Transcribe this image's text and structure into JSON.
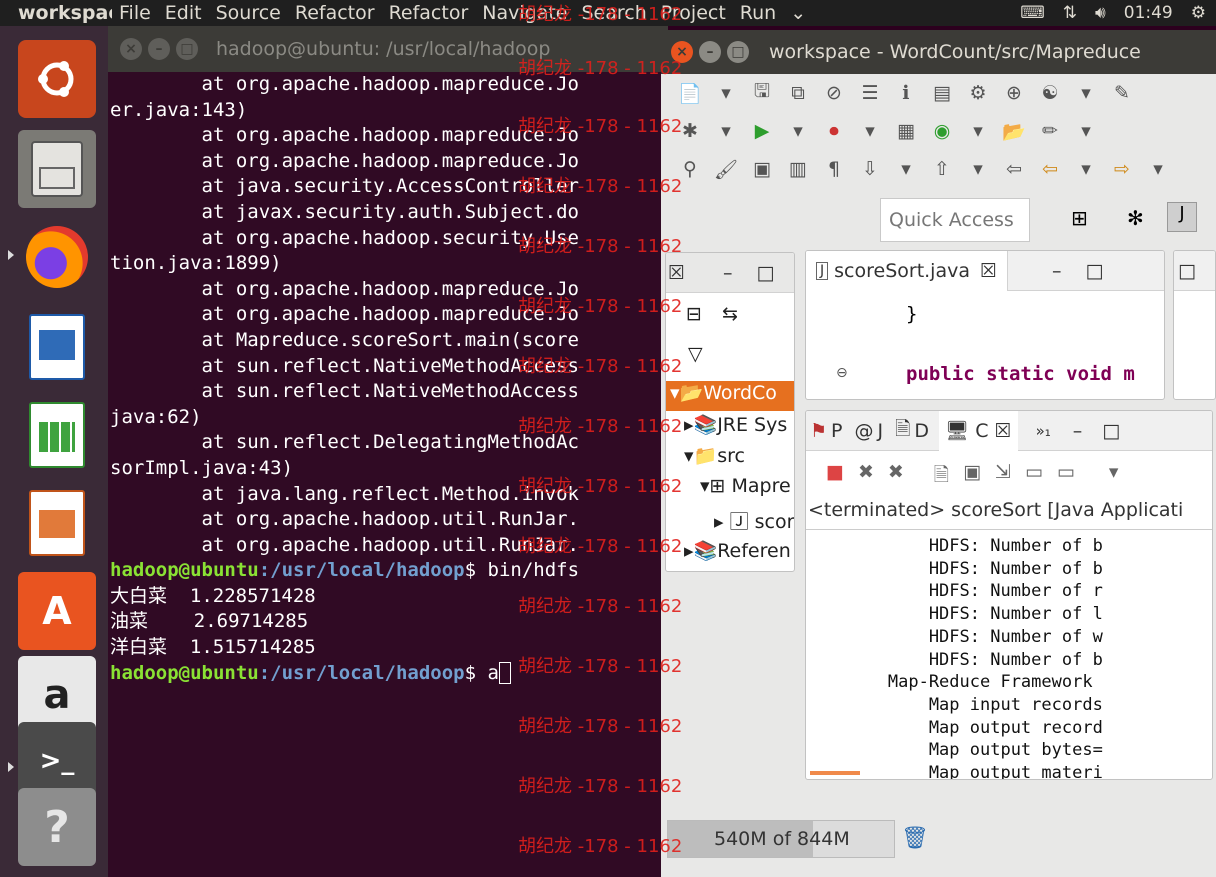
{
  "topbar": {
    "app_name": "workspace",
    "menu": [
      "File",
      "Edit",
      "Source",
      "Refactor",
      "Refactor",
      "Navigate",
      "Search",
      "Project",
      "Run"
    ],
    "clock": "01:49"
  },
  "terminal": {
    "title": "hadoop@ubuntu: /usr/local/hadoop",
    "lines": [
      "        at org.apache.hadoop.mapreduce.Jo",
      "er.java:143)",
      "        at org.apache.hadoop.mapreduce.Jo",
      "        at org.apache.hadoop.mapreduce.Jo",
      "        at java.security.AccessController",
      "        at javax.security.auth.Subject.do",
      "        at org.apache.hadoop.security.Use",
      "tion.java:1899)",
      "        at org.apache.hadoop.mapreduce.Jo",
      "        at org.apache.hadoop.mapreduce.Jo",
      "        at Mapreduce.scoreSort.main(score",
      "        at sun.reflect.NativeMethodAccess",
      "        at sun.reflect.NativeMethodAccess",
      "java:62)",
      "        at sun.reflect.DelegatingMethodAc",
      "sorImpl.java:43)",
      "        at java.lang.reflect.Method.invok",
      "        at org.apache.hadoop.util.RunJar.",
      "        at org.apache.hadoop.util.RunJar."
    ],
    "prompt_user": "hadoop@ubuntu",
    "prompt_path": ":/usr/local/hadoop",
    "prompt_sign": "$",
    "command1": " bin/hdfs",
    "results": [
      {
        "name": "大白菜",
        "value": "1.228571428"
      },
      {
        "name": "油菜",
        "value": "2.69714285"
      },
      {
        "name": "洋白菜",
        "value": "1.515714285"
      }
    ],
    "command2": " a"
  },
  "eclipse": {
    "title": "workspace - WordCount/src/Mapreduce",
    "quick_access": "Quick Access",
    "editor_tab": "scoreSort.java",
    "editor_line1": "}",
    "editor_line2": "public static void m",
    "tree": {
      "project": "WordCo",
      "jre": "JRE Sys",
      "src": "src",
      "package": "Mapre",
      "file": "score",
      "refs": "Referen"
    },
    "bottom_tabs": [
      "P",
      "J",
      "D",
      "C"
    ],
    "console_header": "<terminated> scoreSort [Java Applicati",
    "console_lines": [
      "            HDFS: Number of b",
      "            HDFS: Number of b",
      "            HDFS: Number of r",
      "            HDFS: Number of l",
      "            HDFS: Number of w",
      "            HDFS: Number of b",
      "        Map-Reduce Framework",
      "            Map input records",
      "            Map output record",
      "            Map output bytes=",
      "            Map output materi"
    ],
    "heap": "540M of 844M",
    "heap_used_fraction": 0.64
  },
  "watermark": "胡纪龙 -178 - 1162"
}
